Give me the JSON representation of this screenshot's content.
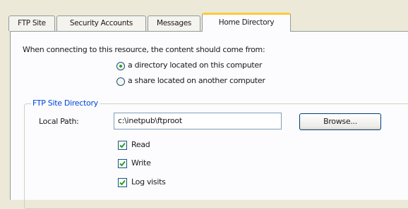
{
  "tabs": [
    {
      "label": "FTP Site"
    },
    {
      "label": "Security Accounts"
    },
    {
      "label": "Messages"
    },
    {
      "label": "Home Directory",
      "active": true
    }
  ],
  "content": {
    "prompt": "When connecting to this resource, the content should come from:",
    "source_options": [
      {
        "label": "a directory located on this computer",
        "selected": true
      },
      {
        "label": "a share located on another computer",
        "selected": false
      }
    ]
  },
  "ftp_site_directory": {
    "legend": "FTP Site Directory",
    "local_path_label": "Local Path:",
    "local_path_value": "c:\\inetpub\\ftproot",
    "browse_label": "Browse...",
    "permissions": [
      {
        "label": "Read",
        "checked": true
      },
      {
        "label": "Write",
        "checked": true
      },
      {
        "label": "Log visits",
        "checked": true
      }
    ]
  },
  "colors": {
    "background": "#ece9d8",
    "panel": "#fcfcfe",
    "active_tab_accent": "#ffc83c",
    "legend_text": "#0046d5",
    "radio_dot": "#21a121",
    "check_mark": "#21a121"
  }
}
